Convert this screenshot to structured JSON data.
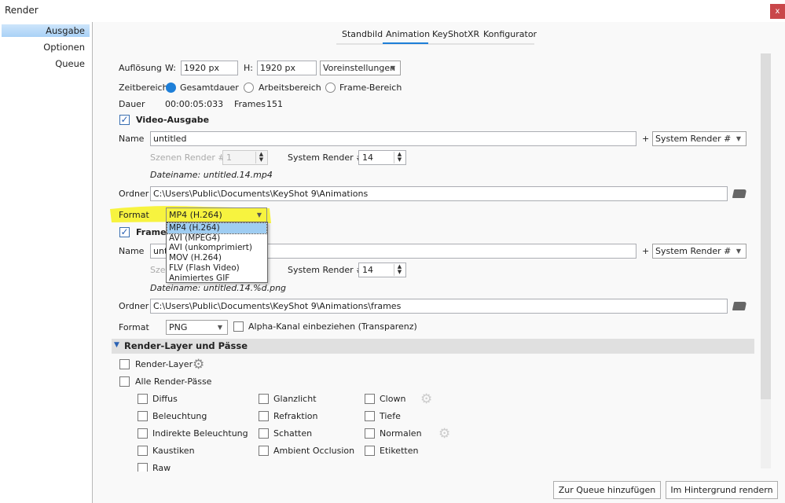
{
  "window": {
    "title": "Render",
    "close_label": "x"
  },
  "sidebar": {
    "items": [
      {
        "label": "Ausgabe",
        "selected": true
      },
      {
        "label": "Optionen"
      },
      {
        "label": "Queue"
      }
    ]
  },
  "tabs": [
    {
      "label": "Standbild"
    },
    {
      "label": "Animation",
      "active": true
    },
    {
      "label": "KeyShotXR"
    },
    {
      "label": "Konfigurator"
    }
  ],
  "resolution": {
    "label": "Auflösung",
    "w_label": "W:",
    "w_value": "1920 px",
    "h_label": "H:",
    "h_value": "1920 px",
    "presets": "Voreinstellungen"
  },
  "timerange": {
    "label": "Zeitbereich",
    "options": [
      {
        "label": "Gesamtdauer",
        "selected": true
      },
      {
        "label": "Arbeitsbereich"
      },
      {
        "label": "Frame-Bereich"
      }
    ]
  },
  "duration": {
    "label": "Dauer",
    "value": "00:00:05:033",
    "frames_label": "Frames",
    "frames_value": "151"
  },
  "video": {
    "checkbox_label": "Video-Ausgabe",
    "checked": true,
    "name_label": "Name",
    "name_value": "untitled",
    "plus": "+",
    "suffix_select": "System Render #",
    "scene_render_label": "Szenen Render #",
    "scene_render_value": "1",
    "system_render_label": "System Render #",
    "system_render_value": "14",
    "filename": "Dateiname: untitled.14.mp4",
    "folder_label": "Ordner",
    "folder_value": "C:\\Users\\Public\\Documents\\KeyShot 9\\Animations",
    "format_label": "Format",
    "format_value": "MP4 (H.264)",
    "format_options": [
      "MP4 (H.264)",
      "AVI (MPEG4)",
      "AVI (unkomprimiert)",
      "MOV (H.264)",
      "FLV (Flash Video)",
      "Animiertes GIF"
    ]
  },
  "frames": {
    "checkbox_label": "Frames",
    "checked": true,
    "name_label": "Name",
    "name_value": "untitled",
    "plus": "+",
    "suffix_select": "System Render #",
    "scene_render_label": "Szenen Render #",
    "system_render_label": "System Render #",
    "system_render_value": "14",
    "filename": "Dateiname: untitled.14.%d.png",
    "folder_label": "Ordner",
    "folder_value": "C:\\Users\\Public\\Documents\\KeyShot 9\\Animations\\frames",
    "format_label": "Format",
    "format_value": "PNG",
    "alpha_label": "Alpha-Kanal einbeziehen (Transparenz)"
  },
  "passes": {
    "section_title": "Render-Layer und Pässe",
    "render_layer": "Render-Layer",
    "all_passes": "Alle Render-Pässe",
    "col1": [
      "Diffus",
      "Beleuchtung",
      "Indirekte Beleuchtung",
      "Kaustiken",
      "Raw"
    ],
    "col2": [
      "Glanzlicht",
      "Refraktion",
      "Schatten",
      "Ambient Occlusion"
    ],
    "col3": [
      "Clown",
      "Tiefe",
      "Normalen",
      "Etiketten"
    ]
  },
  "buttons": {
    "queue": "Zur Queue hinzufügen",
    "background": "Im Hintergrund rendern"
  },
  "colors": {
    "accent": "#1e7fd8",
    "highlight": "#f5f000",
    "close": "#c9474a"
  }
}
